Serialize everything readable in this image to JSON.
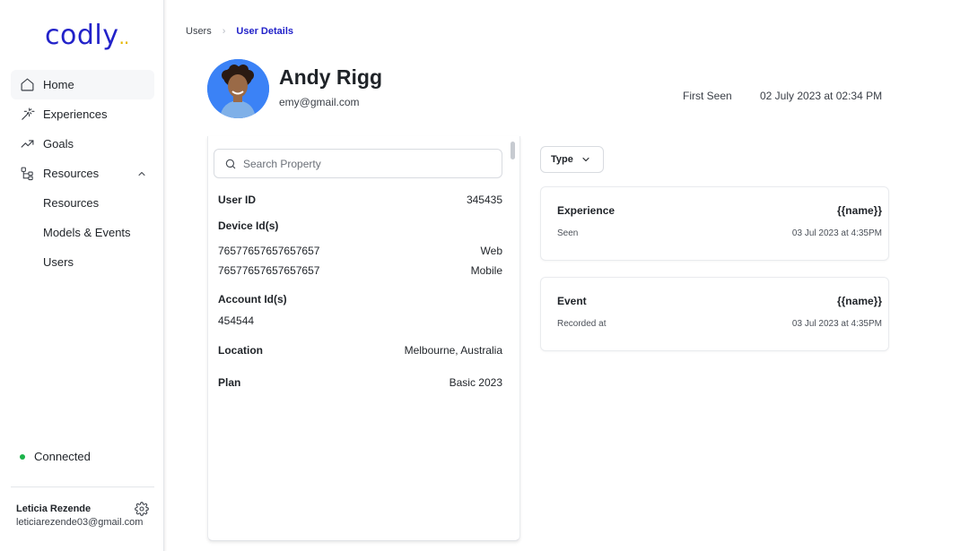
{
  "brand": {
    "name": "codly",
    "dots": "..",
    "color": "#2222c9",
    "dot_color": "#e6b800"
  },
  "sidebar": {
    "items": [
      {
        "label": "Home",
        "icon": "home-icon",
        "active": true
      },
      {
        "label": "Experiences",
        "icon": "magic-wand-icon"
      },
      {
        "label": "Goals",
        "icon": "trending-up-icon"
      },
      {
        "label": "Resources",
        "icon": "hierarchy-icon",
        "expanded": true
      }
    ],
    "sub_items": [
      {
        "label": "Resources"
      },
      {
        "label": "Models & Events"
      },
      {
        "label": "Users"
      }
    ],
    "status": {
      "label": "Connected",
      "color": "#1bb34a"
    },
    "user": {
      "name": "Leticia Rezende",
      "email": "leticiarezende03@gmail.com"
    }
  },
  "breadcrumb": {
    "parent": "Users",
    "current": "User Details"
  },
  "profile": {
    "name": "Andy Rigg",
    "email": "emy@gmail.com",
    "first_seen_label": "First Seen",
    "first_seen_value": "02 July 2023 at 02:34 PM"
  },
  "properties": {
    "search_placeholder": "Search Property",
    "user_id_label": "User ID",
    "user_id_value": "345435",
    "device_ids_label": "Device Id(s)",
    "devices": [
      {
        "id": "76577657657657657",
        "type": "Web"
      },
      {
        "id": "76577657657657657",
        "type": "Mobile"
      }
    ],
    "account_ids_label": "Account Id(s)",
    "account_id": "454544",
    "location_label": "Location",
    "location_value": "Melbourne, Australia",
    "plan_label": "Plan",
    "plan_value": "Basic 2023"
  },
  "activity": {
    "filter_label": "Type",
    "cards": [
      {
        "title": "Experience",
        "name": "{{name}}",
        "sub_label": "Seen",
        "time": "03 Jul 2023 at 4:35PM"
      },
      {
        "title": "Event",
        "name": "{{name}}",
        "sub_label": "Recorded at",
        "time": "03 Jul 2023 at 4:35PM"
      }
    ]
  }
}
